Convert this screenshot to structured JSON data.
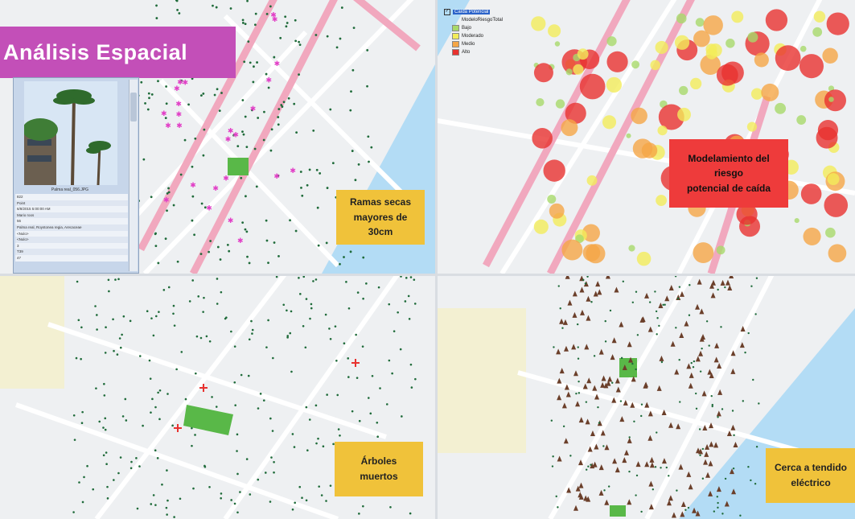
{
  "title": "Análisis Espacial",
  "panels": {
    "top_left": {
      "label_line1": "Ramas secas",
      "label_line2": "mayores de 30cm"
    },
    "top_right": {
      "label_line1": "Modelamiento del riesgo",
      "label_line2": "potencial de caída"
    },
    "bottom_left": {
      "label_line1": "Árboles",
      "label_line2": "muertos"
    },
    "bottom_right": {
      "label_line1": "Cerca a tendido",
      "label_line2": "eléctrico"
    }
  },
  "popup": {
    "caption": "Palma real_056.JPG",
    "rows": [
      "822",
      "Point",
      "6/8/2015 5:00:00 AM",
      "Mario roos",
      "56",
      "Palma real, Roystonea regia, Arecaceae",
      "<Nulo>",
      "<Nulo>",
      "3",
      "T39",
      "47"
    ]
  },
  "legend": {
    "layer": "Caída Potencial",
    "field": "ModeloRiesgoTotal",
    "classes": [
      {
        "label": "Bajo",
        "color": "#a8d96a"
      },
      {
        "label": "Moderado",
        "color": "#f2ec5a"
      },
      {
        "label": "Medio",
        "color": "#f5a646"
      },
      {
        "label": "Alto",
        "color": "#e8322f"
      }
    ]
  },
  "colors": {
    "water": "#b3dcf5",
    "road_pink": "#f1a8be",
    "tree_dot": "#1f6b3a",
    "park": "#59b848",
    "label_yellow": "#f0c23a",
    "label_red": "#ee3b3b",
    "banner_magenta": "#c34fb8"
  }
}
